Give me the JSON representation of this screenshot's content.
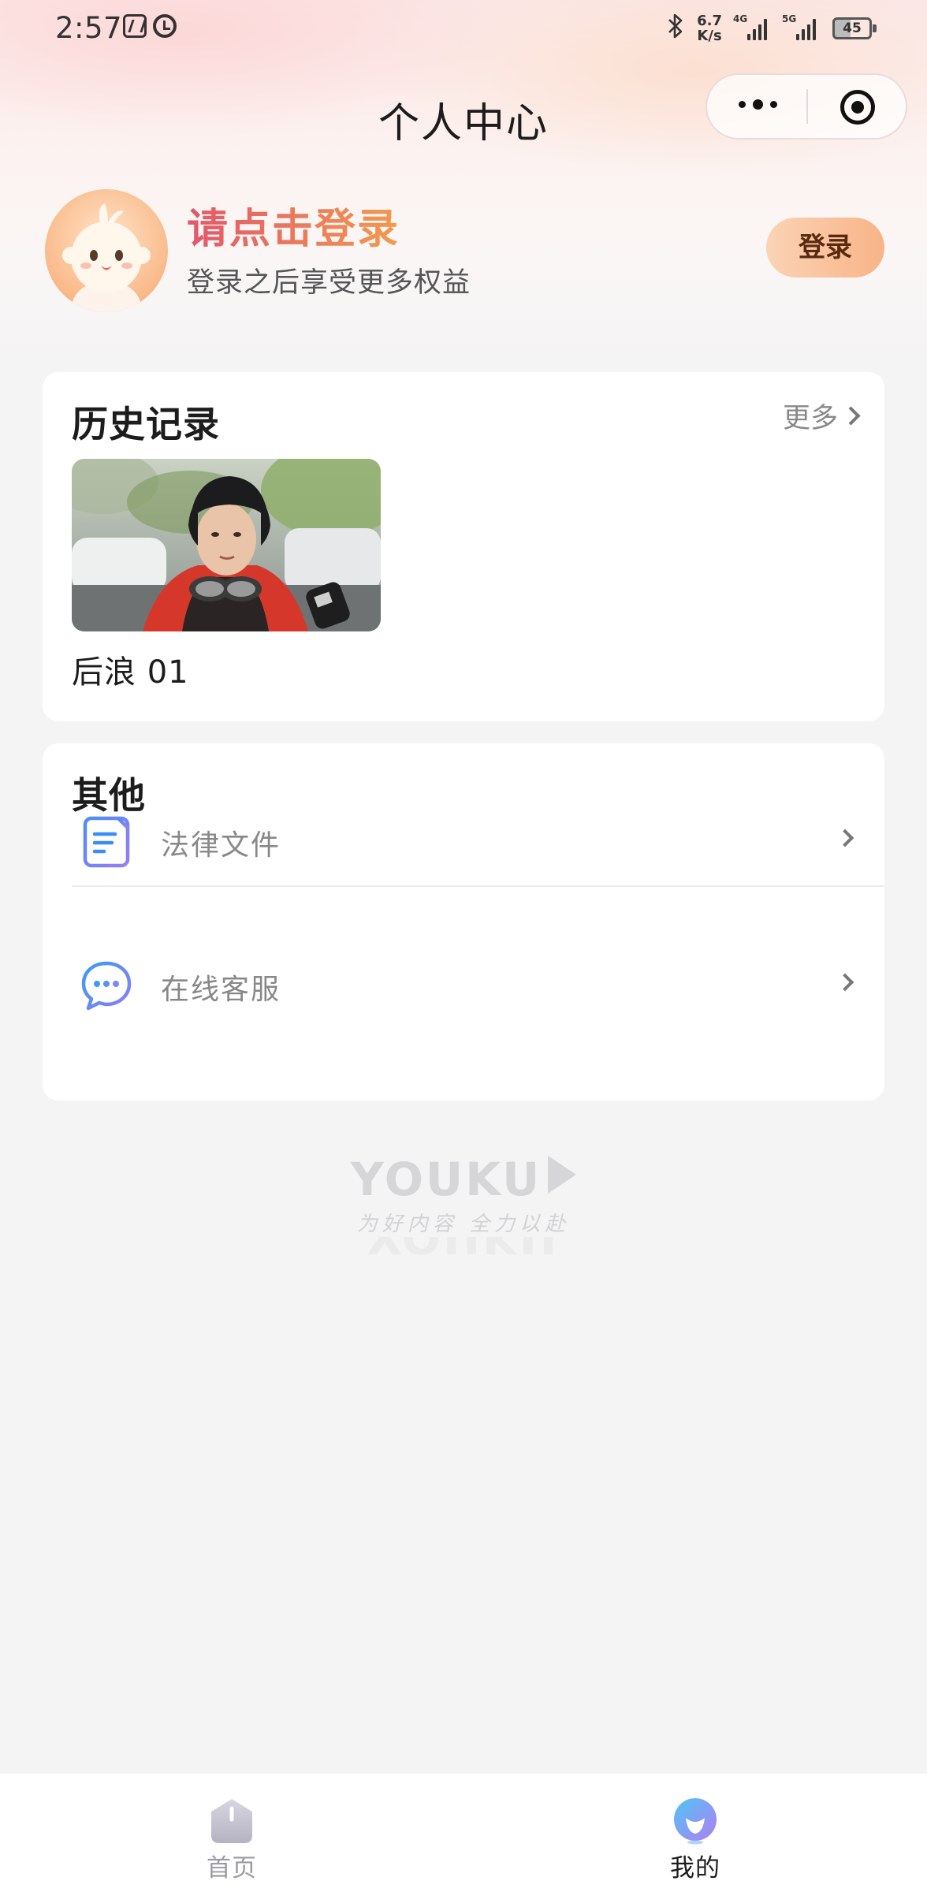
{
  "status_bar": {
    "time": "2:57",
    "net_speed_value": "6.7",
    "net_speed_unit": "K/s",
    "network_1": "4G",
    "network_2": "5G",
    "battery": "45",
    "icons": [
      "nfc-icon",
      "alarm-icon",
      "bluetooth-icon",
      "signal-icon",
      "battery-icon"
    ]
  },
  "header": {
    "title": "个人中心",
    "capsule_icons": [
      "more-icon",
      "close-target-icon"
    ]
  },
  "profile": {
    "title": "请点击登录",
    "subtitle": "登录之后享受更多权益",
    "login_button": "登录",
    "colors": {
      "title_start": "#e2576b",
      "title_end": "#f29a4e",
      "button": "#f8b488"
    }
  },
  "history": {
    "title": "历史记录",
    "more_label": "更多",
    "items": [
      {
        "title": "后浪 01"
      }
    ]
  },
  "others": {
    "title": "其他",
    "items": [
      {
        "label": "法律文件",
        "icon": "document-icon"
      },
      {
        "label": "在线客服",
        "icon": "chat-bubble-icon"
      }
    ]
  },
  "brand": {
    "name": "YOUKU",
    "slogan": "为好内容 全力以赴"
  },
  "tab_bar": {
    "tabs": [
      {
        "label": "首页",
        "icon": "home-icon",
        "active": false
      },
      {
        "label": "我的",
        "icon": "mine-icon",
        "active": true
      }
    ]
  }
}
